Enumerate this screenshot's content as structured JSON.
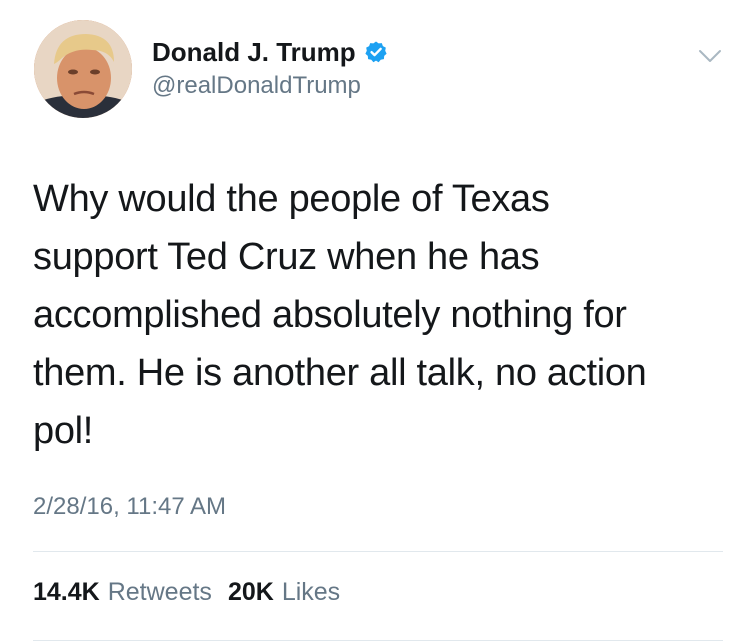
{
  "tweet": {
    "author": {
      "display_name": "Donald J. Trump",
      "handle": "@realDonaldTrump",
      "verified": true,
      "avatar_icon": "profile-photo",
      "verified_icon": "verified-badge-icon"
    },
    "menu_icon": "chevron-down-icon",
    "text_lines": [
      "Why would the people of Texas",
      "support Ted Cruz when he has",
      "accomplished absolutely nothing for",
      "them. He is another all talk, no action",
      "pol!"
    ],
    "timestamp": "2/28/16, 11:47 AM",
    "stats": {
      "retweets_count": "14.4K",
      "retweets_label": "Retweets",
      "likes_count": "20K",
      "likes_label": "Likes"
    }
  },
  "colors": {
    "text": "#14171a",
    "secondary": "#657786",
    "verified": "#1da1f2",
    "divider": "#e1e8ed"
  }
}
